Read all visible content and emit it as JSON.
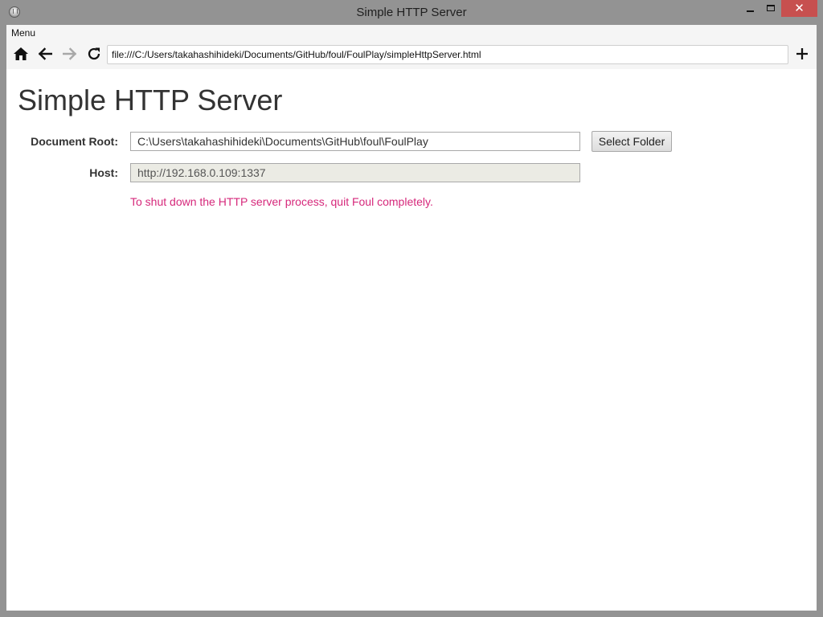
{
  "window": {
    "title": "Simple HTTP Server",
    "close_glyph": "✕"
  },
  "menubar": {
    "menu_label": "Menu"
  },
  "toolbar": {
    "url": "file:///C:/Users/takahashihideki/Documents/GitHub/foul/FoulPlay/simpleHttpServer.html",
    "icons": [
      "home-icon",
      "back-arrow-icon",
      "forward-arrow-icon",
      "reload-icon",
      "plus-icon"
    ]
  },
  "page": {
    "title": "Simple HTTP Server",
    "document_root_label": "Document Root:",
    "document_root_value": "C:\\Users\\takahashihideki\\Documents\\GitHub\\foul\\FoulPlay",
    "select_folder_label": "Select Folder",
    "host_label": "Host:",
    "host_value": "http://192.168.0.109:1337",
    "notice": "To shut down the HTTP server process, quit Foul completely."
  },
  "colors": {
    "notice_text": "#d6287b",
    "close_button": "#c7504f",
    "window_frame": "#939393"
  }
}
